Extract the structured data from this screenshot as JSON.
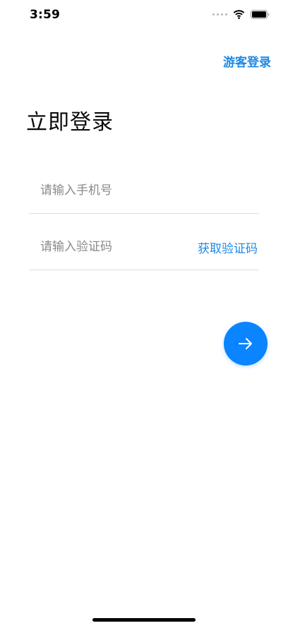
{
  "status_bar": {
    "time": "3:59"
  },
  "header": {
    "guest_login": "游客登录"
  },
  "main": {
    "title": "立即登录",
    "phone_field": {
      "placeholder": "请输入手机号",
      "value": ""
    },
    "code_field": {
      "placeholder": "请输入验证码",
      "value": "",
      "get_code_label": "获取验证码"
    },
    "next_button_icon": "arrow-right-icon"
  },
  "colors": {
    "accent": "#1e8ae6",
    "button": "#0a84ff"
  }
}
